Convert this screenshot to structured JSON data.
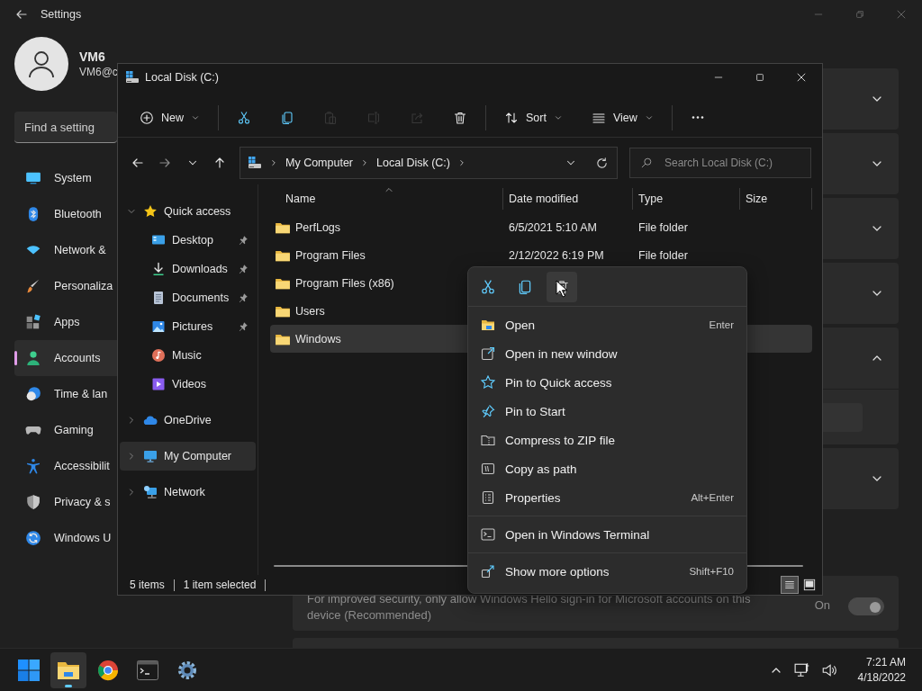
{
  "settings": {
    "title": "Settings",
    "user": {
      "name": "VM6",
      "email": "VM6@c"
    },
    "search": {
      "placeholder": "Find a setting"
    },
    "nav": [
      {
        "kind": "system",
        "label": "System",
        "selected": false
      },
      {
        "kind": "bluetooth",
        "label": "Bluetooth",
        "selected": false
      },
      {
        "kind": "network",
        "label": "Network &",
        "selected": false
      },
      {
        "kind": "personalization",
        "label": "Personaliza",
        "selected": false
      },
      {
        "kind": "apps",
        "label": "Apps",
        "selected": false
      },
      {
        "kind": "accounts",
        "label": "Accounts",
        "selected": true
      },
      {
        "kind": "time",
        "label": "Time & lan",
        "selected": false
      },
      {
        "kind": "gaming",
        "label": "Gaming",
        "selected": false
      },
      {
        "kind": "accessibility",
        "label": "Accessibilit",
        "selected": false
      },
      {
        "kind": "privacy",
        "label": "Privacy & s",
        "selected": false
      },
      {
        "kind": "update",
        "label": "Windows U",
        "selected": false
      }
    ],
    "cards": [
      {
        "expanded": false
      },
      {
        "expanded": false
      },
      {
        "expanded": false
      },
      {
        "expanded": false
      },
      {
        "expanded": true
      },
      {
        "expanded": false
      }
    ],
    "hello_option": {
      "text": "For improved security, only allow Windows Hello sign-in for Microsoft accounts on this device (Recommended)",
      "state": "On",
      "on": true,
      "disabled": true
    }
  },
  "explorer": {
    "title": "Local Disk (C:)",
    "toolbar": [
      {
        "items": [
          {
            "kind": "new",
            "label": "New",
            "disabled": false
          }
        ]
      },
      {
        "items": [
          {
            "kind": "cut",
            "disabled": false
          },
          {
            "kind": "copy",
            "disabled": false
          },
          {
            "kind": "paste",
            "disabled": true
          },
          {
            "kind": "rename",
            "disabled": true
          },
          {
            "kind": "share",
            "disabled": true
          },
          {
            "kind": "delete",
            "disabled": false
          }
        ]
      },
      {
        "items": [
          {
            "kind": "sort",
            "label": "Sort",
            "disabled": false
          },
          {
            "kind": "view",
            "label": "View",
            "disabled": false
          }
        ]
      },
      {
        "items": [
          {
            "kind": "more",
            "disabled": false
          }
        ]
      }
    ],
    "breadcrumb": [
      "My Computer",
      "Local Disk (C:)"
    ],
    "search": {
      "placeholder": "Search Local Disk (C:)"
    },
    "columns": [
      "Name",
      "Date modified",
      "Type",
      "Size"
    ],
    "rows": [
      {
        "name": "PerfLogs",
        "date": "6/5/2021 5:10 AM",
        "type": "File folder",
        "selected": false
      },
      {
        "name": "Program Files",
        "date": "2/12/2022 6:19 PM",
        "type": "File folder",
        "selected": false
      },
      {
        "name": "Program Files (x86)",
        "selected": false
      },
      {
        "name": "Users",
        "selected": false
      },
      {
        "name": "Windows",
        "selected": true
      }
    ],
    "tree": [
      {
        "kind": "star",
        "label": "Quick access",
        "expanded": true,
        "selected": false,
        "children": [
          {
            "kind": "desktop",
            "label": "Desktop",
            "pinned": true,
            "selected": false
          },
          {
            "kind": "download",
            "label": "Downloads",
            "pinned": true,
            "selected": false
          },
          {
            "kind": "document",
            "label": "Documents",
            "pinned": true,
            "selected": false
          },
          {
            "kind": "picture",
            "label": "Pictures",
            "pinned": true,
            "selected": false
          },
          {
            "kind": "music",
            "label": "Music",
            "pinned": false,
            "selected": false
          },
          {
            "kind": "video",
            "label": "Videos",
            "pinned": false,
            "selected": false
          }
        ]
      },
      {
        "kind": "cloud",
        "label": "OneDrive",
        "expanded": false,
        "selected": false
      },
      {
        "kind": "computer",
        "label": "My Computer",
        "expanded": false,
        "selected": true
      },
      {
        "kind": "network",
        "label": "Network",
        "expanded": false,
        "selected": false
      }
    ],
    "status": [
      "5 items",
      "1 item selected"
    ],
    "view_modes": [
      {
        "kind": "details",
        "selected": true
      },
      {
        "kind": "tiles",
        "selected": false
      }
    ]
  },
  "context_menu": {
    "quick_actions": [
      {
        "kind": "cut",
        "hovered": false
      },
      {
        "kind": "copy",
        "hovered": false
      },
      {
        "kind": "delete",
        "hovered": true
      }
    ],
    "sections": [
      {
        "items": [
          {
            "kind": "open",
            "label": "Open",
            "shortcut": "Enter"
          },
          {
            "kind": "new-window",
            "label": "Open in new window"
          },
          {
            "kind": "pin-quick",
            "label": "Pin to Quick access"
          },
          {
            "kind": "pin-start",
            "label": "Pin to Start"
          },
          {
            "kind": "zip",
            "label": "Compress to ZIP file"
          },
          {
            "kind": "copy-path",
            "label": "Copy as path"
          },
          {
            "kind": "properties",
            "label": "Properties",
            "shortcut": "Alt+Enter"
          }
        ]
      },
      {
        "items": [
          {
            "kind": "terminal",
            "label": "Open in Windows Terminal"
          }
        ]
      },
      {
        "items": [
          {
            "kind": "more",
            "label": "Show more options",
            "shortcut": "Shift+F10"
          }
        ]
      }
    ]
  },
  "taskbar": {
    "apps": [
      {
        "kind": "start",
        "active": false
      },
      {
        "kind": "explorer",
        "active": true
      },
      {
        "kind": "browser",
        "active": false
      },
      {
        "kind": "terminal",
        "active": false
      },
      {
        "kind": "settings",
        "active": false
      }
    ],
    "time": "7:21 AM",
    "date": "4/18/2022"
  }
}
